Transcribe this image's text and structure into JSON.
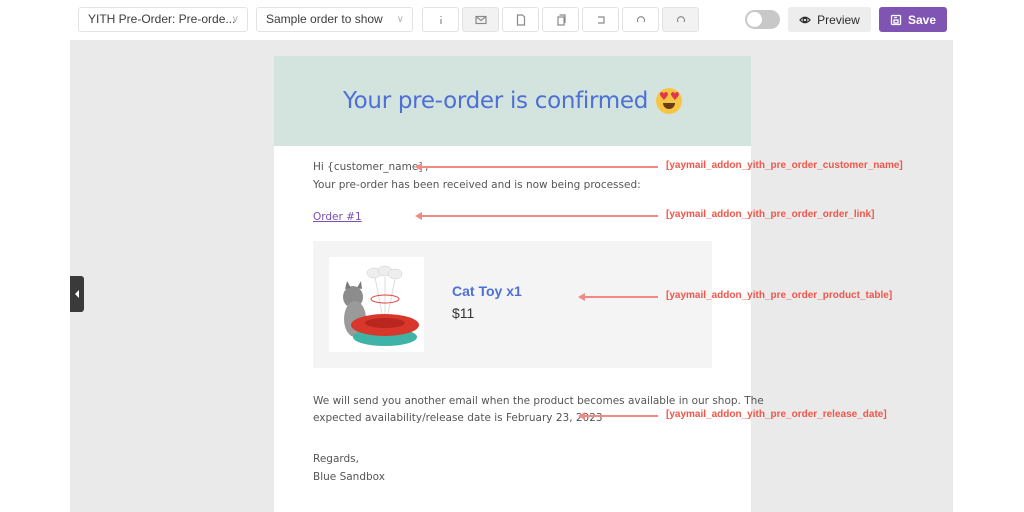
{
  "toolbar": {
    "template_select": "YITH Pre-Order: Pre-orde...",
    "order_select": "Sample order to show",
    "icon_buttons": [
      {
        "name": "info-icon",
        "active": false
      },
      {
        "name": "mail-icon",
        "active": true
      },
      {
        "name": "document-icon",
        "active": false
      },
      {
        "name": "copy-icon",
        "active": false
      },
      {
        "name": "reset-icon",
        "active": false
      },
      {
        "name": "undo-icon",
        "active": false
      },
      {
        "name": "redo-icon",
        "active": true
      }
    ],
    "toggle_on": false,
    "preview_label": "Preview",
    "save_label": "Save",
    "accent_color": "#7f54b3"
  },
  "email": {
    "header_title": "Your pre-order is confirmed",
    "header_emoji": "smiling-face-with-heart-eyes",
    "header_bg": "#d3e4de",
    "greeting": "Hi {customer_name},",
    "intro": "Your pre-order has been received and is now being processed:",
    "order_link": "Order #1",
    "product": {
      "name": "Cat Toy x1",
      "price": "$11",
      "image": "cat-toy-product-image"
    },
    "availability_line1": "We will send you another email when the product becomes available in our shop. The",
    "availability_line2": "expected availability/release date is February 23, 2023",
    "regards": "Regards,",
    "signature": "Blue Sandbox"
  },
  "annotations": [
    {
      "label": "[yaymail_addon_yith_pre_order_customer_name]"
    },
    {
      "label": "[yaymail_addon_yith_pre_order_order_link]"
    },
    {
      "label": "[yaymail_addon_yith_pre_order_product_table]"
    },
    {
      "label": "[yaymail_addon_yith_pre_order_release_date]"
    }
  ]
}
